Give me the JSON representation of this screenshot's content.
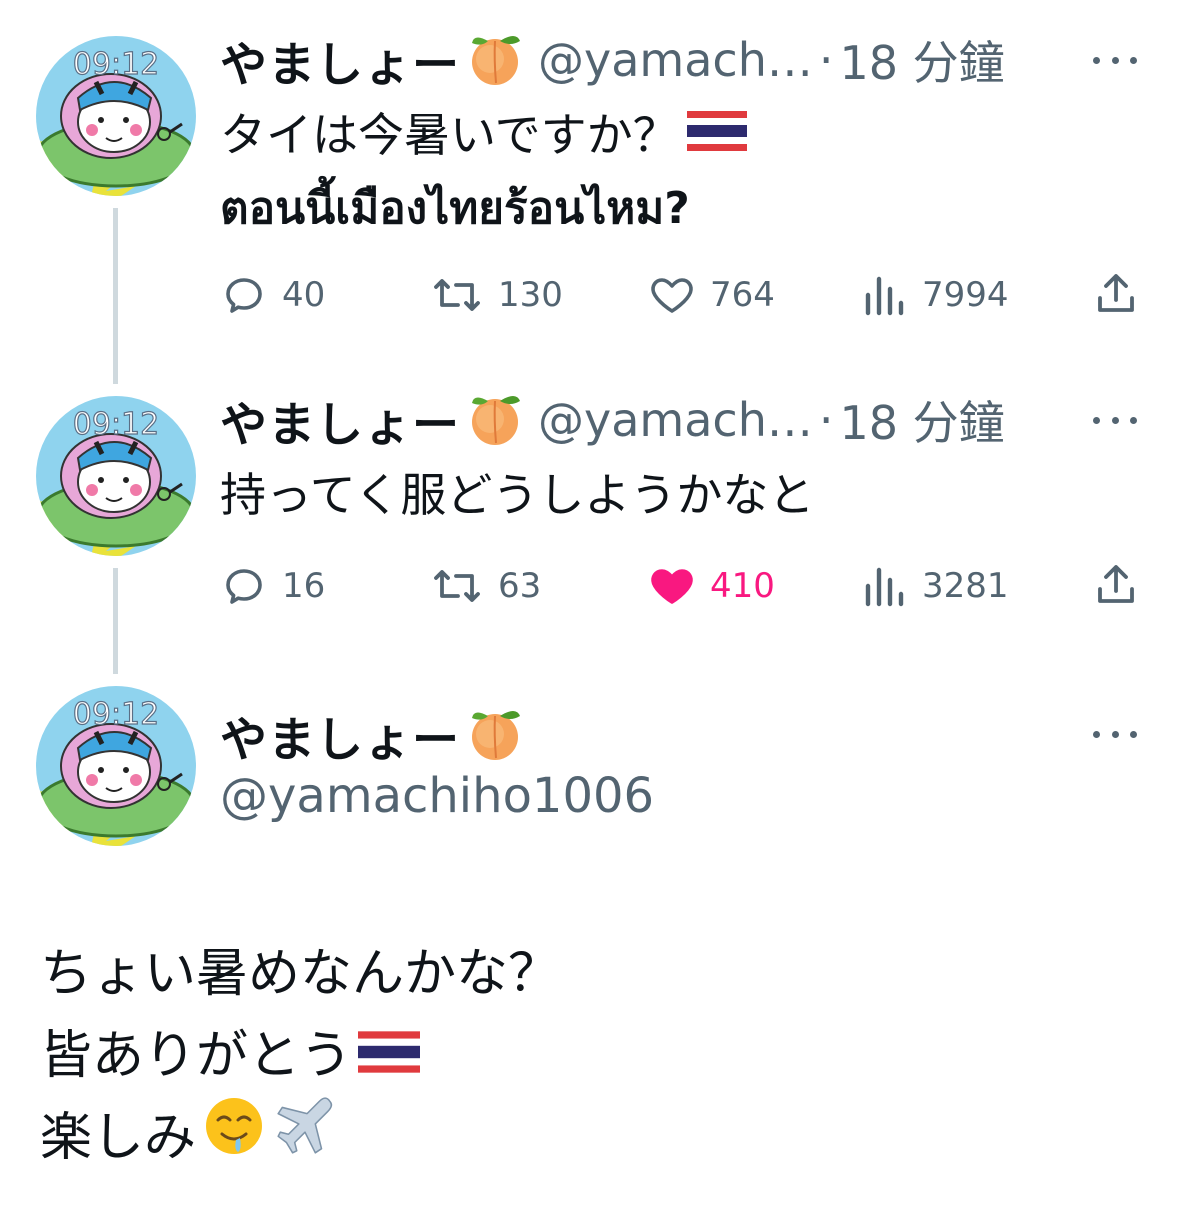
{
  "thread": [
    {
      "display_name": "やましょー",
      "handle": "@yamach…",
      "separator": "·",
      "time": "18 分鐘",
      "text_line1": "タイは今暑いですか？",
      "text_line2": "ตอนนี้เมืองไทยร้อนไหม?",
      "replies": "40",
      "retweets": "130",
      "likes": "764",
      "views": "7994",
      "liked": false
    },
    {
      "display_name": "やましょー",
      "handle": "@yamach…",
      "separator": "·",
      "time": "18 分鐘",
      "text_line1": "持ってく服どうしようかなと",
      "replies": "16",
      "retweets": "63",
      "likes": "410",
      "views": "3281",
      "liked": true
    }
  ],
  "main_tweet": {
    "display_name": "やましょー",
    "handle": "@yamachiho1006",
    "lines": [
      "ちょい暑めなんかな？",
      "皆ありがとう",
      "楽しみ"
    ]
  },
  "avatar": {
    "clock_text": "09:12"
  },
  "colors": {
    "text_primary": "#0f1419",
    "text_secondary": "#536471",
    "like_active": "#f91880",
    "thread_line": "#cfd9de"
  },
  "icons": {
    "reply": "speech-bubble-icon",
    "retweet": "retweet-arrows-icon",
    "like": "heart-icon",
    "views": "bar-chart-icon",
    "share": "share-upload-icon",
    "more": "ellipsis-icon"
  }
}
